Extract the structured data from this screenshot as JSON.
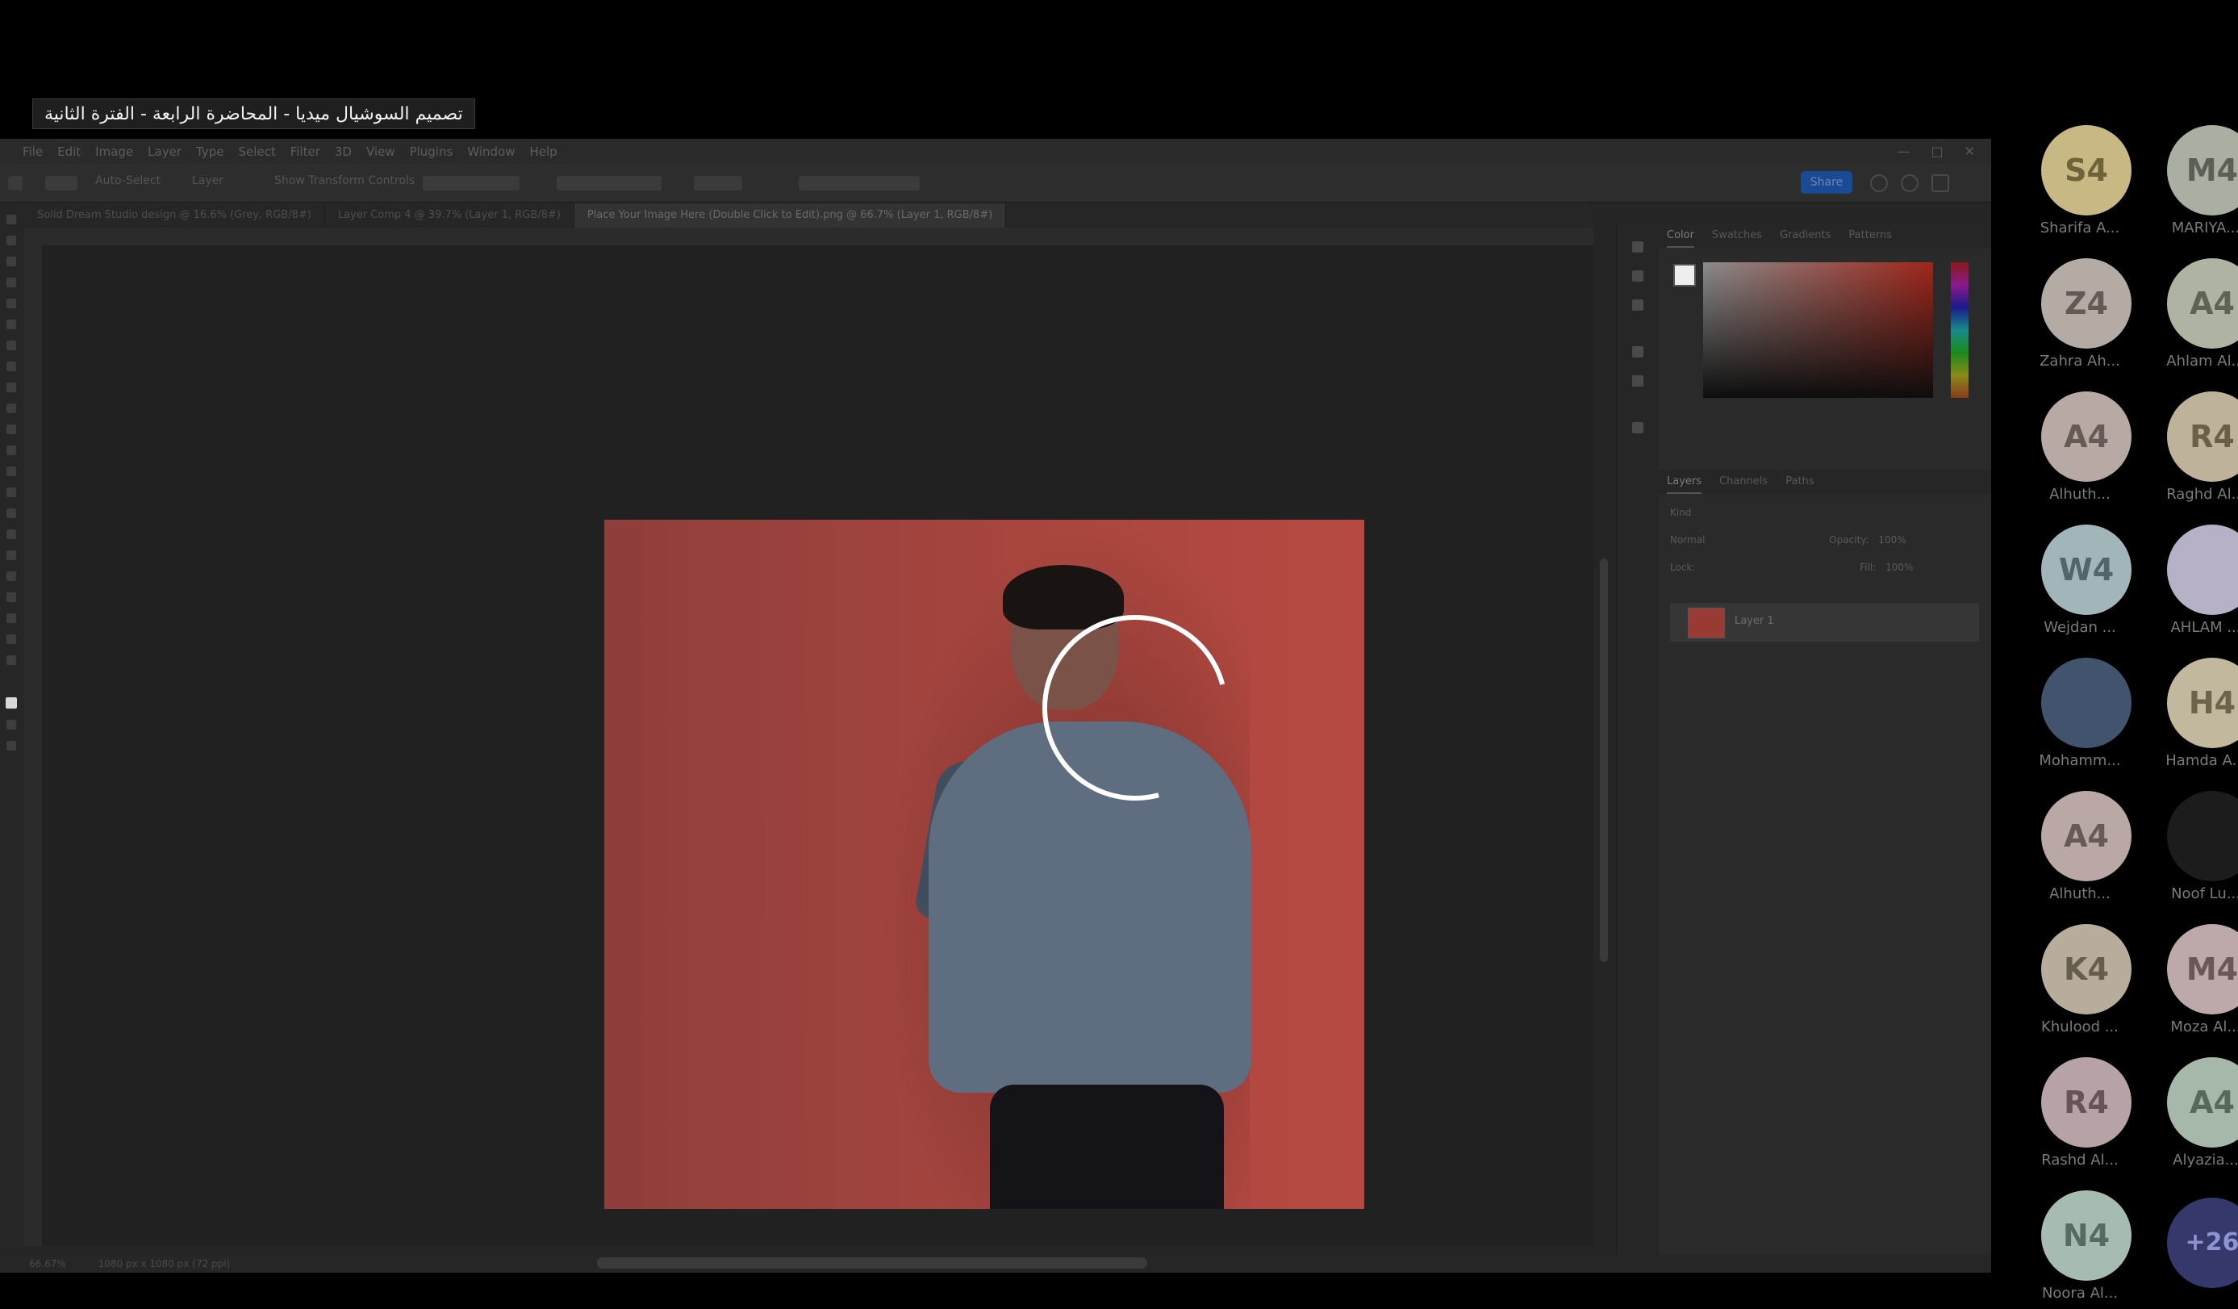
{
  "meeting": {
    "title": "تصميم السوشيال ميديا - المحاضرة الرابعة - الفترة الثانية"
  },
  "photoshop": {
    "menu": [
      "File",
      "Edit",
      "Image",
      "Layer",
      "Type",
      "Select",
      "Filter",
      "3D",
      "View",
      "Plugins",
      "Window",
      "Help"
    ],
    "options": {
      "auto_select": "Auto-Select",
      "layer": "Layer",
      "transform_controls": "Show Transform Controls",
      "share": "Share"
    },
    "tabs": [
      "Solid Dream Studio design @ 16.6% (Grey, RGB/8#)",
      "Layer Comp 4 @ 39.7% (Layer 1, RGB/8#)",
      "Place Your Image Here (Double Click to Edit).png @ 66.7% (Layer 1, RGB/8#)"
    ],
    "color_panel_tabs": [
      "Color",
      "Swatches",
      "Gradients",
      "Patterns"
    ],
    "layer_panel_tabs": [
      "Layers",
      "Channels",
      "Paths"
    ],
    "layers": {
      "kind_filter": "Kind",
      "blend_mode": "Normal",
      "opacity_label": "Opacity:",
      "opacity": "100%",
      "lock_label": "Lock:",
      "fill_label": "Fill:",
      "fill": "100%",
      "layer_name": "Layer 1"
    },
    "status": {
      "zoom": "66.67%",
      "doc_size": "1080 px x 1080 px (72 ppi)"
    }
  },
  "participants": [
    {
      "initials": "S4",
      "name": "Sharifa A...",
      "bg": "#c8b883",
      "fg": "#6f633c"
    },
    {
      "initials": "M4",
      "name": "MARIYA...",
      "bg": "#a9b0a2",
      "fg": "#5a6055"
    },
    {
      "initials": "Z4",
      "name": "Zahra Ah...",
      "bg": "#b5aba5",
      "fg": "#625a55"
    },
    {
      "initials": "A4",
      "name": "Ahlam Al...",
      "bg": "#aeb3a3",
      "fg": "#5e6354"
    },
    {
      "initials": "A4",
      "name": "Alhuth...",
      "bg": "#b8a9a5",
      "fg": "#665a56"
    },
    {
      "initials": "R4",
      "name": "Raghd Al...",
      "bg": "#bfb29a",
      "fg": "#6a5f48"
    },
    {
      "initials": "W4",
      "name": "Wejdan ...",
      "bg": "#a2b6ba",
      "fg": "#51656a"
    },
    {
      "initials": "",
      "name": "AHLAM ...",
      "bg": "#b7b1c8",
      "fg": "#5a3a9e"
    },
    {
      "initials": "",
      "name": "Mohamm...",
      "bg": "#42536e",
      "fg": "#dddddd"
    },
    {
      "initials": "H4",
      "name": "Hamda A...",
      "bg": "#c1b89e",
      "fg": "#6b644d"
    },
    {
      "initials": "A4",
      "name": "Alhuth...",
      "bg": "#b9a8a5",
      "fg": "#665a56"
    },
    {
      "initials": "",
      "name": "Noof Lu...",
      "bg": "#1c1c1c",
      "fg": "#777777"
    },
    {
      "initials": "K4",
      "name": "Khulood ...",
      "bg": "#b8ad9c",
      "fg": "#655d4d"
    },
    {
      "initials": "M4",
      "name": "Moza Al...",
      "bg": "#bda9a9",
      "fg": "#6a5757"
    },
    {
      "initials": "R4",
      "name": "Rashd Al...",
      "bg": "#b7a3a6",
      "fg": "#665459"
    },
    {
      "initials": "A4",
      "name": "Alyazia...",
      "bg": "#a5b8a9",
      "fg": "#566a5b"
    },
    {
      "initials": "N4",
      "name": "Noora Al...",
      "bg": "#a6bcb0",
      "fg": "#566c60"
    }
  ],
  "more_participants": "+26",
  "icons": {
    "loading": "loading-spinner-icon"
  }
}
